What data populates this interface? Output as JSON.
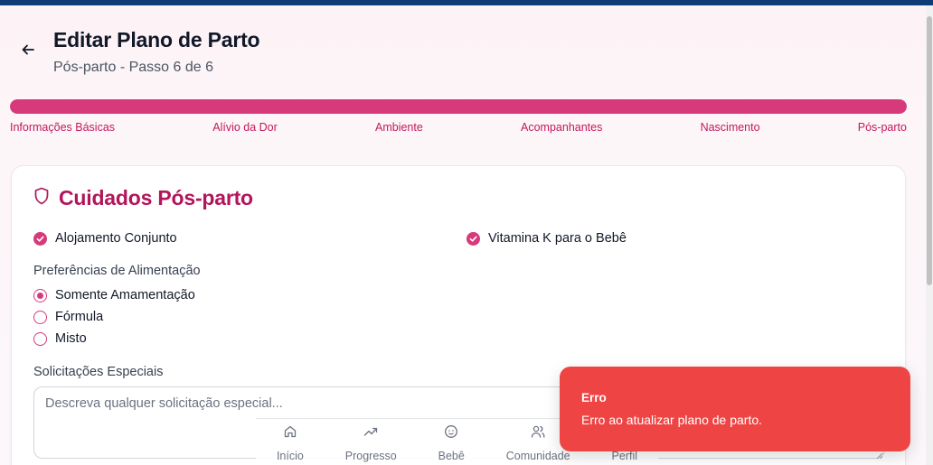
{
  "header": {
    "title": "Editar Plano de Parto",
    "subtitle": "Pós-parto - Passo 6 de 6",
    "back_icon": "arrow-left-icon"
  },
  "progress": {
    "percent": 100,
    "steps": [
      "Informações Básicas",
      "Alívio da Dor",
      "Ambiente",
      "Acompanhantes",
      "Nascimento",
      "Pós-parto"
    ]
  },
  "section": {
    "icon": "shield-icon",
    "title": "Cuidados Pós-parto",
    "checkboxes": [
      {
        "label": "Alojamento Conjunto",
        "checked": true
      },
      {
        "label": "Vitamina K para o Bebê",
        "checked": true
      }
    ],
    "feeding": {
      "label": "Preferências de Alimentação",
      "options": [
        "Somente Amamentação",
        "Fórmula",
        "Misto"
      ],
      "selected": 0
    },
    "special_requests": {
      "label": "Solicitações Especiais",
      "value": "",
      "placeholder": "Descreva qualquer solicitação especial..."
    }
  },
  "bottom_nav": [
    {
      "label": "Início",
      "icon": "home-icon"
    },
    {
      "label": "Progresso",
      "icon": "trending-up-icon"
    },
    {
      "label": "Bebê",
      "icon": "baby-icon"
    },
    {
      "label": "Comunidade",
      "icon": "users-icon"
    },
    {
      "label": "Perfil",
      "icon": "user-icon"
    }
  ],
  "toast": {
    "title": "Erro",
    "message": "Erro ao atualizar plano de parto."
  },
  "colors": {
    "accent": "#d63a7a",
    "title_accent": "#b3155b",
    "error": "#ef4444",
    "topbar": "#0f3b79"
  }
}
